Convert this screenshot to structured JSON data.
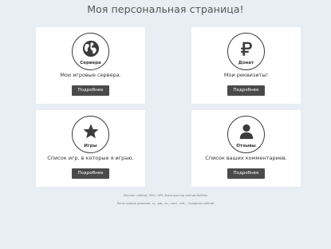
{
  "page": {
    "title": "Моя персональная страница!"
  },
  "cards": [
    {
      "icon": "globe-icon",
      "circle_label": "Сервера",
      "description": "Мои игровые сервера.",
      "button_label": "Подробнее"
    },
    {
      "icon": "ruble-icon",
      "circle_label": "Донат",
      "description": "Мои реквизиты!",
      "button_label": "Подробнее"
    },
    {
      "icon": "star-icon",
      "circle_label": "Игры",
      "description": "Список игр, в которые я играю.",
      "button_label": "Подробнее"
    },
    {
      "icon": "user-icon",
      "circle_label": "Отзывы",
      "description": "Список ваших комментариев.",
      "button_label": "Подробнее"
    }
  ],
  "footer": {
    "line1": "Хостинг сайтов, VDS / VPS, Конструктор сайтов DoSites",
    "line2": "Регистрация доменов .ru, .рф, .su, .com, .net… Создание сайтов"
  },
  "colors": {
    "background": "#e8eef3",
    "card": "#ffffff",
    "button": "#4a4a4a",
    "icon": "#3c3c3c"
  }
}
